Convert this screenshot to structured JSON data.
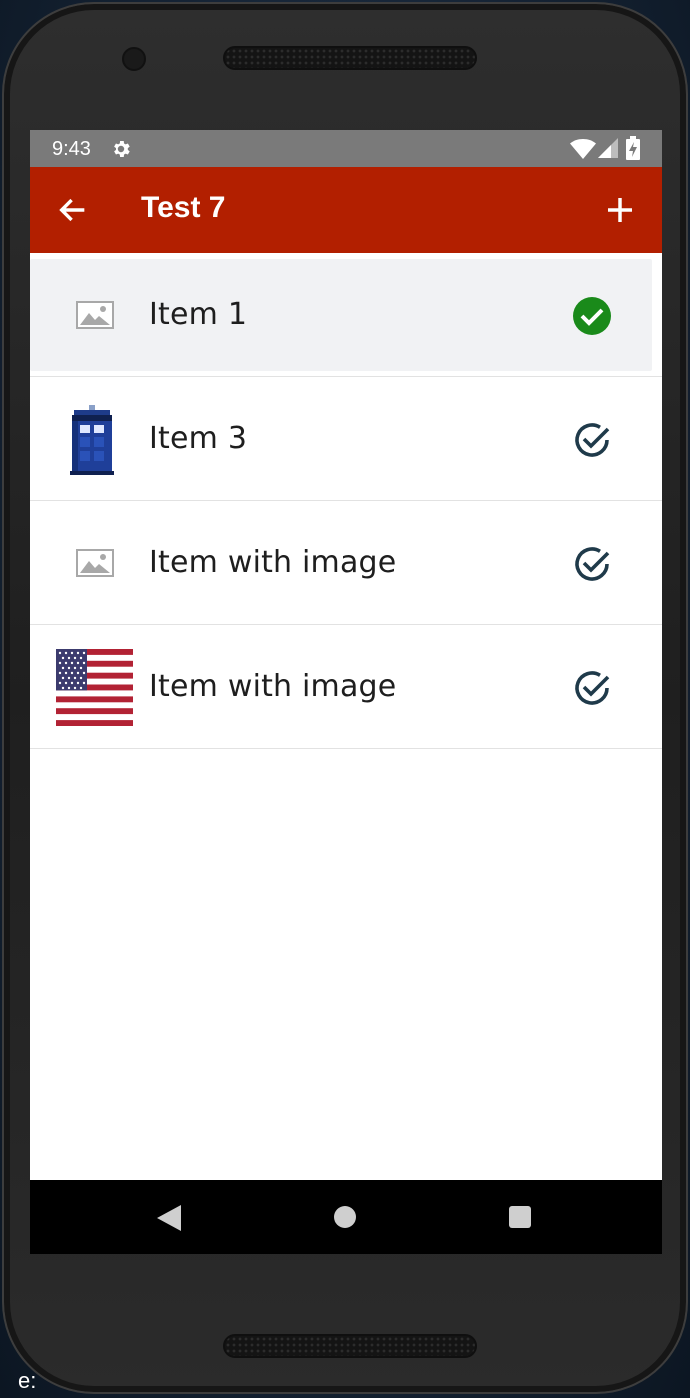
{
  "status_bar": {
    "time": "9:43",
    "icons": [
      "gear-icon",
      "wifi-icon",
      "signal-icon",
      "battery-charging-icon"
    ]
  },
  "app_bar": {
    "title": "Test 7",
    "back_icon": "arrow-left-icon",
    "add_icon": "plus-icon",
    "color": "#b21f00"
  },
  "list": {
    "items": [
      {
        "label": "Item 1",
        "thumbnail": "image-placeholder-icon",
        "check": "check-circle-filled-icon",
        "selected": true
      },
      {
        "label": "Item 3",
        "thumbnail": "tardis-image",
        "check": "check-circle-outline-icon",
        "selected": false
      },
      {
        "label": "Item with image",
        "thumbnail": "image-placeholder-icon",
        "check": "check-circle-outline-icon",
        "selected": false
      },
      {
        "label": "Item with image",
        "thumbnail": "us-flag-image",
        "check": "check-circle-outline-icon",
        "selected": false
      }
    ]
  },
  "nav_bar": {
    "icons": [
      "nav-back-icon",
      "nav-home-icon",
      "nav-recents-icon"
    ]
  },
  "colors": {
    "check_filled": "#1a8a1a",
    "check_outline": "#1f3a4a",
    "selected_row_bg": "#f1f2f4"
  },
  "background": {
    "partial_text": "e:"
  }
}
